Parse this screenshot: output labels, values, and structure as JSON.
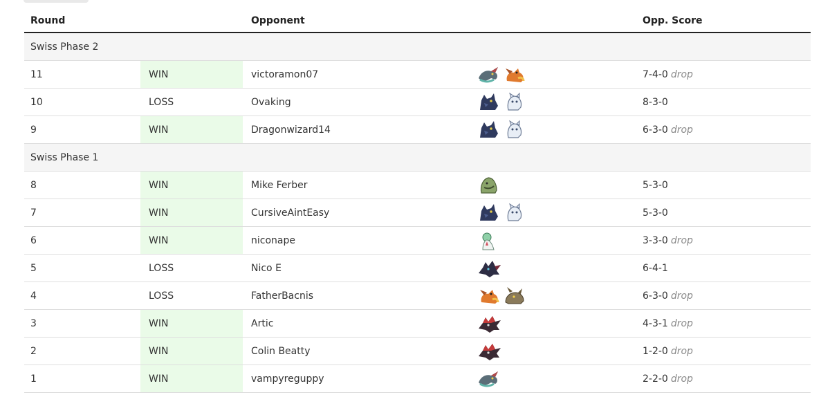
{
  "table": {
    "headers": {
      "round": "Round",
      "result": "",
      "opponent": "Opponent",
      "team": "",
      "score": "Opp. Score"
    },
    "phases": [
      {
        "label": "Swiss Phase 2",
        "rounds": [
          {
            "round": "11",
            "result": "WIN",
            "opponent": "victoramon07",
            "team": [
              "dragapult-icon",
              "charizard-icon"
            ],
            "score": "7-4-0",
            "drop": "drop"
          },
          {
            "round": "10",
            "result": "LOSS",
            "opponent": "Ovaking",
            "team": [
              "dark-wolf-icon",
              "white-creature-icon"
            ],
            "score": "8-3-0",
            "drop": ""
          },
          {
            "round": "9",
            "result": "WIN",
            "opponent": "Dragonwizard14",
            "team": [
              "dark-wolf-icon",
              "white-creature-icon"
            ],
            "score": "6-3-0",
            "drop": "drop"
          }
        ]
      },
      {
        "label": "Swiss Phase 1",
        "rounds": [
          {
            "round": "8",
            "result": "WIN",
            "opponent": "Mike Ferber",
            "team": [
              "green-rock-icon"
            ],
            "score": "5-3-0",
            "drop": ""
          },
          {
            "round": "7",
            "result": "WIN",
            "opponent": "CursiveAintEasy",
            "team": [
              "dark-wolf-icon",
              "white-creature-icon"
            ],
            "score": "5-3-0",
            "drop": ""
          },
          {
            "round": "6",
            "result": "WIN",
            "opponent": "niconape",
            "team": [
              "gardevoir-icon"
            ],
            "score": "3-3-0",
            "drop": "drop"
          },
          {
            "round": "5",
            "result": "LOSS",
            "opponent": "Nico E",
            "team": [
              "zoroark-icon"
            ],
            "score": "6-4-1",
            "drop": ""
          },
          {
            "round": "4",
            "result": "LOSS",
            "opponent": "FatherBacnis",
            "team": [
              "charizard-icon",
              "brown-beast-icon"
            ],
            "score": "6-3-0",
            "drop": "drop"
          },
          {
            "round": "3",
            "result": "WIN",
            "opponent": "Artic",
            "team": [
              "red-zoroark-icon"
            ],
            "score": "4-3-1",
            "drop": "drop"
          },
          {
            "round": "2",
            "result": "WIN",
            "opponent": "Colin Beatty",
            "team": [
              "red-zoroark-icon"
            ],
            "score": "1-2-0",
            "drop": "drop"
          },
          {
            "round": "1",
            "result": "WIN",
            "opponent": "vampyreguppy",
            "team": [
              "dragapult-icon"
            ],
            "score": "2-2-0",
            "drop": "drop"
          }
        ]
      }
    ]
  },
  "colors": {
    "win_background": "#eafbe8",
    "phase_background": "#f5f5f5",
    "drop_text": "#8a8a8a"
  }
}
